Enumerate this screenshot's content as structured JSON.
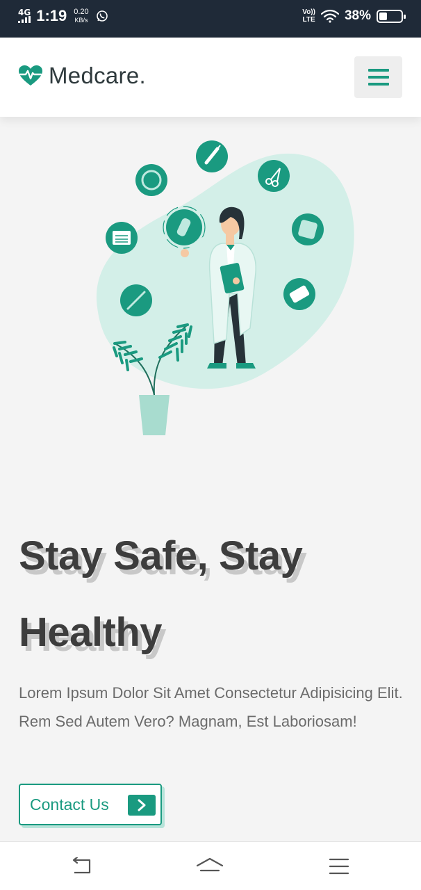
{
  "status_bar": {
    "network_type": "4G",
    "time": "1:19",
    "speed_value": "0.20",
    "speed_unit": "KB/s",
    "volte_top": "Vo))",
    "volte_bottom": "LTE",
    "battery_percent": "38%",
    "battery_level": 0.38,
    "icons": [
      "signal-icon",
      "whatsapp-icon",
      "wifi-icon",
      "battery-icon"
    ]
  },
  "header": {
    "logo_text": "Medcare.",
    "logo_icon": "heart-pulse-icon",
    "menu_icon": "hamburger-menu-icon"
  },
  "hero": {
    "title": "Stay Safe, Stay Healthy",
    "description": "Lorem Ipsum Dolor Sit Amet Consectetur Adipisicing Elit. Rem Sed Autem Vero? Magnam, Est Laboriosam!",
    "cta_label": "Contact Us",
    "cta_icon": "chevron-right-icon",
    "illustration": "doctor-with-medical-icons-illustration"
  },
  "bottom_nav": {
    "icons": [
      "back-icon",
      "home-icon",
      "recents-menu-icon"
    ]
  },
  "colors": {
    "brand": "#1a9a80",
    "brand_light": "#d3efe8",
    "status_bar_bg": "#1f2a38",
    "page_bg": "#f4f4f4",
    "title_text": "#3d3d3d",
    "title_shadow": "#c8c8c8",
    "body_text": "#6b6b6b"
  }
}
